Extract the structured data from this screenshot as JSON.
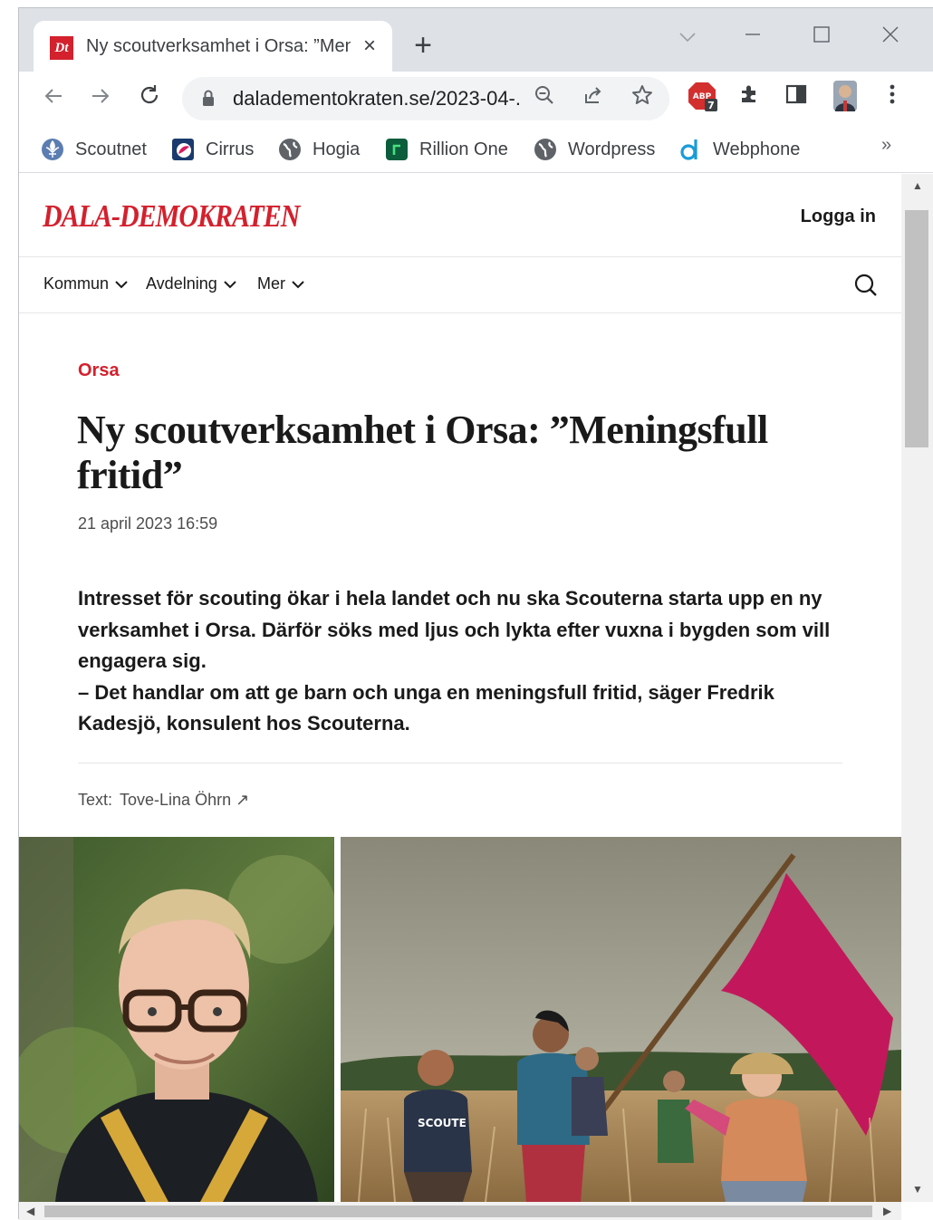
{
  "browser": {
    "tab_title": "Ny scoutverksamhet i Orsa: ”Men",
    "tab_favicon_text": "Dt",
    "url": "daladementokraten.se/2023-04-...",
    "extension_badge": "7",
    "abp_label": "ABP"
  },
  "bookmarks": [
    {
      "label": "Scoutnet",
      "icon": "fleur-de-lis-icon",
      "color": "#3a5a8c"
    },
    {
      "label": "Cirrus",
      "icon": "cirrus-icon",
      "color": "#1a3a6e"
    },
    {
      "label": "Hogia",
      "icon": "globe-icon",
      "color": "#5f6368"
    },
    {
      "label": "Rillion One",
      "icon": "rillion-icon",
      "color": "#0b5d3b"
    },
    {
      "label": "Wordpress",
      "icon": "globe-icon",
      "color": "#5f6368"
    },
    {
      "label": "Webphone",
      "icon": "webphone-icon",
      "color": "#1a9bd7"
    }
  ],
  "bookmarks_more": "»",
  "site": {
    "logo": "DALA-DEMOKRATEN",
    "login": "Logga in",
    "nav": [
      "Kommun",
      "Avdelning",
      "Mer"
    ]
  },
  "article": {
    "category": "Orsa",
    "headline": "Ny scoutverksamhet i Orsa: ”Meningsfull fritid”",
    "date": "21 april 2023 16:59",
    "lead_p1": "Intresset för scouting ökar i hela landet och nu ska Scouterna starta upp en ny verksamhet i Orsa. Därför söks med ljus och lykta efter vuxna i bygden som vill engagera sig.",
    "lead_p2": "– Det handlar om att ge barn och unga en meningsfull fritid, säger Fredrik Kadesjö, konsulent hos Scouterna.",
    "byline_label": "Text:",
    "byline_author": "Tove-Lina Öhrn ↗",
    "photo2_shirt_text": "SCOUTE"
  },
  "colors": {
    "brand_red": "#d3212d",
    "flag_pink": "#c2185b"
  }
}
